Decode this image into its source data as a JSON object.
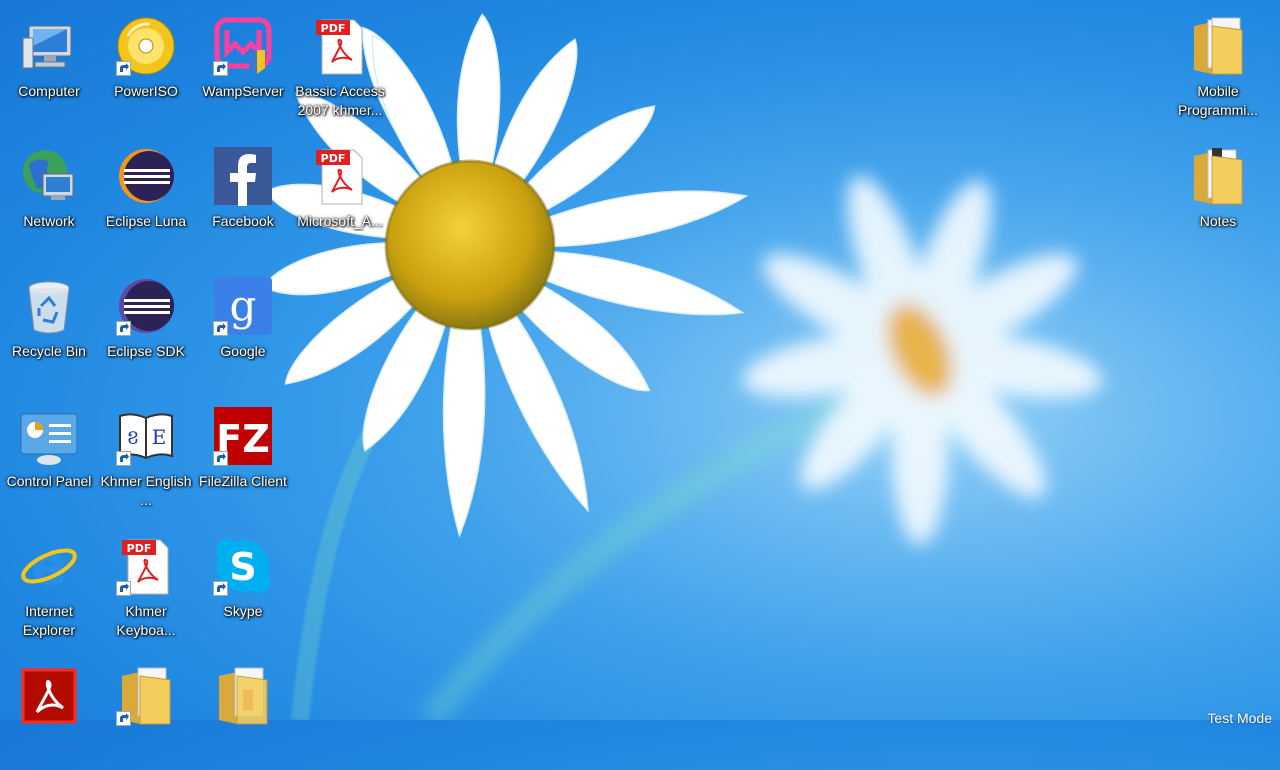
{
  "desktop": {
    "icons": [
      {
        "label": "Computer",
        "icon": "computer-icon",
        "shortcut": false
      },
      {
        "label": "PowerISO",
        "icon": "poweriso-icon",
        "shortcut": true
      },
      {
        "label": "WampServer",
        "icon": "wampserver-icon",
        "shortcut": true
      },
      {
        "label": "Bassic Access 2007 khmer...",
        "icon": "pdf-icon",
        "shortcut": false
      },
      {
        "label": "Network",
        "icon": "network-icon",
        "shortcut": false
      },
      {
        "label": "Eclipse Luna",
        "icon": "eclipse-icon",
        "shortcut": false
      },
      {
        "label": "Facebook",
        "icon": "facebook-icon",
        "shortcut": false
      },
      {
        "label": "Microsoft_A...",
        "icon": "pdf-icon",
        "shortcut": false
      },
      {
        "label": "Recycle Bin",
        "icon": "recycle-bin-icon",
        "shortcut": false
      },
      {
        "label": "Eclipse SDK",
        "icon": "eclipse-icon",
        "shortcut": true
      },
      {
        "label": "Google",
        "icon": "google-icon",
        "shortcut": true
      },
      {
        "label": "Control Panel",
        "icon": "control-panel-icon",
        "shortcut": false
      },
      {
        "label": "Khmer English ...",
        "icon": "dictionary-icon",
        "shortcut": true
      },
      {
        "label": "FileZilla Client",
        "icon": "filezilla-icon",
        "shortcut": true
      },
      {
        "label": "Internet Explorer",
        "icon": "internet-explorer-icon",
        "shortcut": false
      },
      {
        "label": "Khmer Keyboa...",
        "icon": "pdf-icon",
        "shortcut": true
      },
      {
        "label": "Skype",
        "icon": "skype-icon",
        "shortcut": true
      },
      {
        "label": "Mobile Programmi...",
        "icon": "folder-icon",
        "shortcut": false
      },
      {
        "label": "Notes",
        "icon": "folder-icon",
        "shortcut": false
      },
      {
        "label": "",
        "icon": "adobe-acrobat-icon",
        "shortcut": false
      },
      {
        "label": "",
        "icon": "folder-icon",
        "shortcut": true
      },
      {
        "label": "",
        "icon": "folder-icon",
        "shortcut": false
      }
    ],
    "pdf_badge": "PDF",
    "watermark": "Test Mode"
  },
  "colors": {
    "sky": "#1f86e0",
    "pdf_red": "#e02020",
    "facebook_blue": "#3b5998",
    "skype_blue": "#00aff0",
    "filezilla_red": "#bf0000"
  }
}
